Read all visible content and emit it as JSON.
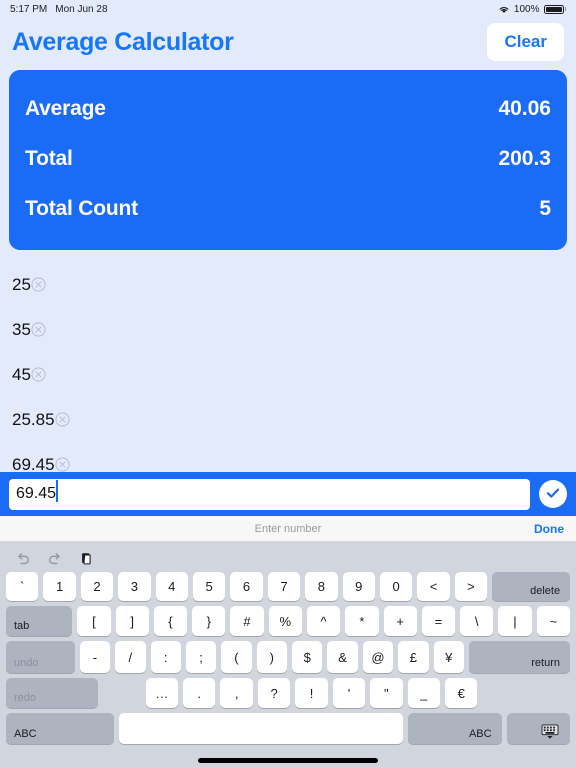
{
  "statusbar": {
    "time": "5:17 PM",
    "date": "Mon Jun 28",
    "battery_percent": "100%",
    "wifi_icon": "wifi-icon",
    "battery_icon": "battery-icon"
  },
  "header": {
    "title": "Average Calculator",
    "clear_label": "Clear",
    "accent_color": "#1677f8"
  },
  "summary": {
    "card_color": "#1a6bf5",
    "rows": [
      {
        "label": "Average",
        "value": "40.06"
      },
      {
        "label": "Total",
        "value": "200.3"
      },
      {
        "label": "Total Count",
        "value": "5"
      }
    ]
  },
  "list": {
    "items": [
      {
        "value": "25",
        "delete_icon": "circle-x-icon"
      },
      {
        "value": "35",
        "delete_icon": "circle-x-icon"
      },
      {
        "value": "45",
        "delete_icon": "circle-x-icon"
      },
      {
        "value": "25.85",
        "delete_icon": "circle-x-icon"
      },
      {
        "value": "69.45",
        "delete_icon": "circle-x-icon"
      }
    ]
  },
  "input": {
    "value": "69.45",
    "placeholder": "",
    "confirm_icon": "check-circle-icon"
  },
  "accessory": {
    "placeholder": "Enter number",
    "done_label": "Done"
  },
  "keyboard": {
    "toolbar": [
      {
        "name": "undo-icon",
        "state": "disabled"
      },
      {
        "name": "redo-icon",
        "state": "disabled"
      },
      {
        "name": "paste-icon",
        "state": "enabled"
      }
    ],
    "rows": [
      {
        "keys": [
          {
            "label": "`",
            "type": "normal"
          },
          {
            "label": "1",
            "type": "normal"
          },
          {
            "label": "2",
            "type": "normal"
          },
          {
            "label": "3",
            "type": "normal"
          },
          {
            "label": "4",
            "type": "normal"
          },
          {
            "label": "5",
            "type": "normal"
          },
          {
            "label": "6",
            "type": "normal"
          },
          {
            "label": "7",
            "type": "normal"
          },
          {
            "label": "8",
            "type": "normal"
          },
          {
            "label": "9",
            "type": "normal"
          },
          {
            "label": "0",
            "type": "normal"
          },
          {
            "label": "<",
            "type": "normal"
          },
          {
            "label": ">",
            "type": "normal"
          },
          {
            "label": "delete",
            "type": "mod-br",
            "flex": 2.1
          }
        ]
      },
      {
        "keys": [
          {
            "label": "tab",
            "type": "mod-bl",
            "flex": 1.75
          },
          {
            "label": "[",
            "type": "normal"
          },
          {
            "label": "]",
            "type": "normal"
          },
          {
            "label": "{",
            "type": "normal"
          },
          {
            "label": "}",
            "type": "normal"
          },
          {
            "label": "#",
            "type": "normal"
          },
          {
            "label": "%",
            "type": "normal"
          },
          {
            "label": "^",
            "type": "normal"
          },
          {
            "label": "*",
            "type": "normal"
          },
          {
            "label": "+",
            "type": "normal"
          },
          {
            "label": "=",
            "type": "normal"
          },
          {
            "label": "\\",
            "type": "normal"
          },
          {
            "label": "|",
            "type": "normal"
          },
          {
            "label": "~",
            "type": "normal"
          }
        ]
      },
      {
        "keys": [
          {
            "label": "undo",
            "type": "mod-bl-dim",
            "flex": 2.0
          },
          {
            "label": "-",
            "type": "normal"
          },
          {
            "label": "/",
            "type": "normal"
          },
          {
            "label": ":",
            "type": "normal"
          },
          {
            "label": ";",
            "type": "normal"
          },
          {
            "label": "(",
            "type": "normal"
          },
          {
            "label": ")",
            "type": "normal"
          },
          {
            "label": "$",
            "type": "normal"
          },
          {
            "label": "&",
            "type": "normal"
          },
          {
            "label": "@",
            "type": "normal"
          },
          {
            "label": "£",
            "type": "normal"
          },
          {
            "label": "¥",
            "type": "normal"
          },
          {
            "label": "return",
            "type": "mod-br",
            "flex": 3.0
          }
        ]
      },
      {
        "keys": [
          {
            "label": "redo",
            "type": "mod-bl-dim",
            "flex": 2.6
          },
          {
            "label": "",
            "type": "spacer",
            "flex": 1.15
          },
          {
            "label": "…",
            "type": "normal"
          },
          {
            "label": ".",
            "type": "normal"
          },
          {
            "label": ",",
            "type": "normal"
          },
          {
            "label": "?",
            "type": "normal"
          },
          {
            "label": "!",
            "type": "normal"
          },
          {
            "label": "'",
            "type": "normal"
          },
          {
            "label": "\"",
            "type": "normal"
          },
          {
            "label": "_",
            "type": "normal"
          },
          {
            "label": "€",
            "type": "normal"
          },
          {
            "label": "",
            "type": "spacer",
            "flex": 2.7
          }
        ]
      },
      {
        "keys": [
          {
            "label": "ABC",
            "type": "mod-bl",
            "flex": 3.0
          },
          {
            "label": "",
            "type": "space",
            "flex": 8.5
          },
          {
            "label": "ABC",
            "type": "mod-br",
            "flex": 2.5
          },
          {
            "label": "keyboard-dismiss-icon",
            "type": "mod-dismiss",
            "flex": 1.6
          }
        ]
      }
    ]
  }
}
